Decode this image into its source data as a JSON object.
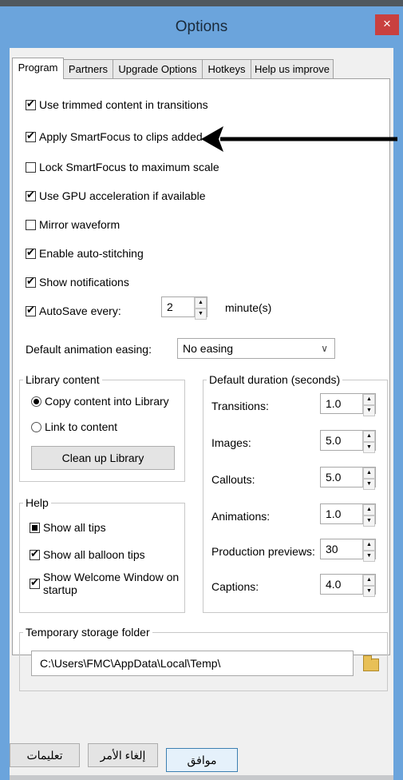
{
  "window": {
    "title": "Options",
    "close_glyph": "×"
  },
  "tabs": [
    "Program",
    "Partners",
    "Upgrade Options",
    "Hotkeys",
    "Help us improve"
  ],
  "program": {
    "options": [
      {
        "label": "Use trimmed content in transitions",
        "checked": true
      },
      {
        "label": "Apply SmartFocus to clips added",
        "checked": true
      },
      {
        "label": "Lock SmartFocus to maximum scale",
        "checked": false
      },
      {
        "label": "Use GPU acceleration if available",
        "checked": true
      },
      {
        "label": "Mirror waveform",
        "checked": false
      },
      {
        "label": "Enable auto-stitching",
        "checked": true
      },
      {
        "label": "Show notifications",
        "checked": true
      }
    ],
    "autosave": {
      "label": "AutoSave every:",
      "checked": true,
      "value": "2",
      "unit": "minute(s)"
    },
    "easing": {
      "label": "Default animation easing:",
      "value": "No easing"
    },
    "library": {
      "legend": "Library content",
      "copy_label": "Copy content into Library",
      "link_label": "Link to content",
      "cleanup_label": "Clean up Library"
    },
    "help": {
      "legend": "Help",
      "show_tips": "Show all tips",
      "show_balloon": "Show all balloon tips",
      "show_welcome_1": "Show Welcome Window on",
      "show_welcome_2": "startup"
    },
    "durations": {
      "legend": "Default duration (seconds)",
      "items": [
        {
          "label": "Transitions:",
          "value": "1.0"
        },
        {
          "label": "Images:",
          "value": "5.0"
        },
        {
          "label": "Callouts:",
          "value": "5.0"
        },
        {
          "label": "Animations:",
          "value": "1.0"
        },
        {
          "label": "Production previews:",
          "value": "30"
        },
        {
          "label": "Captions:",
          "value": "4.0"
        }
      ]
    },
    "temp": {
      "legend": "Temporary storage folder",
      "path": "C:\\Users\\FMC\\AppData\\Local\\Temp\\"
    }
  },
  "footer": {
    "ok": "موافق",
    "cancel": "إلغاء الأمر",
    "help": "تعليمات"
  },
  "colors": {
    "titlebar": "#6ba4dc",
    "close": "#c9403f"
  },
  "icons": {
    "close": "close-icon",
    "folder": "folder-icon",
    "arrow": "arrow-left-icon"
  }
}
